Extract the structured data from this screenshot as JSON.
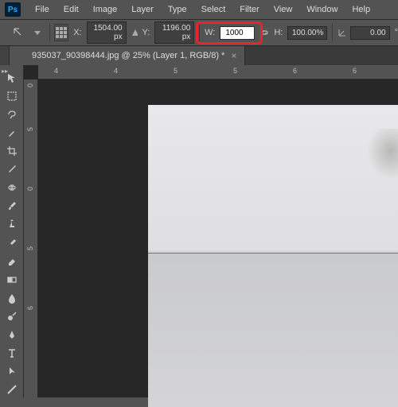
{
  "app": {
    "logo": "Ps"
  },
  "menu": [
    "File",
    "Edit",
    "Image",
    "Layer",
    "Type",
    "Select",
    "Filter",
    "View",
    "Window",
    "Help"
  ],
  "options": {
    "x_label": "X:",
    "x_value": "1504.00 px",
    "y_label": "Y:",
    "y_value": "1196.00 px",
    "w_label": "W:",
    "w_value": "1000",
    "h_label": "H:",
    "h_value": "100.00%",
    "angle_label": "",
    "angle_value": "0.00",
    "trailing": "°"
  },
  "tab": {
    "title": "935037_90398444.jpg @ 25% (Layer 1, RGB/8) *",
    "close": "×"
  },
  "toolbar_icons": [
    "move",
    "marquee",
    "lasso",
    "wand",
    "crop",
    "eyedropper",
    "heal",
    "brush",
    "stamp",
    "history-brush",
    "eraser",
    "gradient",
    "blur",
    "dodge",
    "pen",
    "type",
    "path-select",
    "line"
  ],
  "ruler_h": [
    "4",
    "4",
    "5",
    "5",
    "6",
    "6"
  ],
  "ruler_v": [
    "0",
    "5",
    "0",
    "5",
    "6"
  ]
}
